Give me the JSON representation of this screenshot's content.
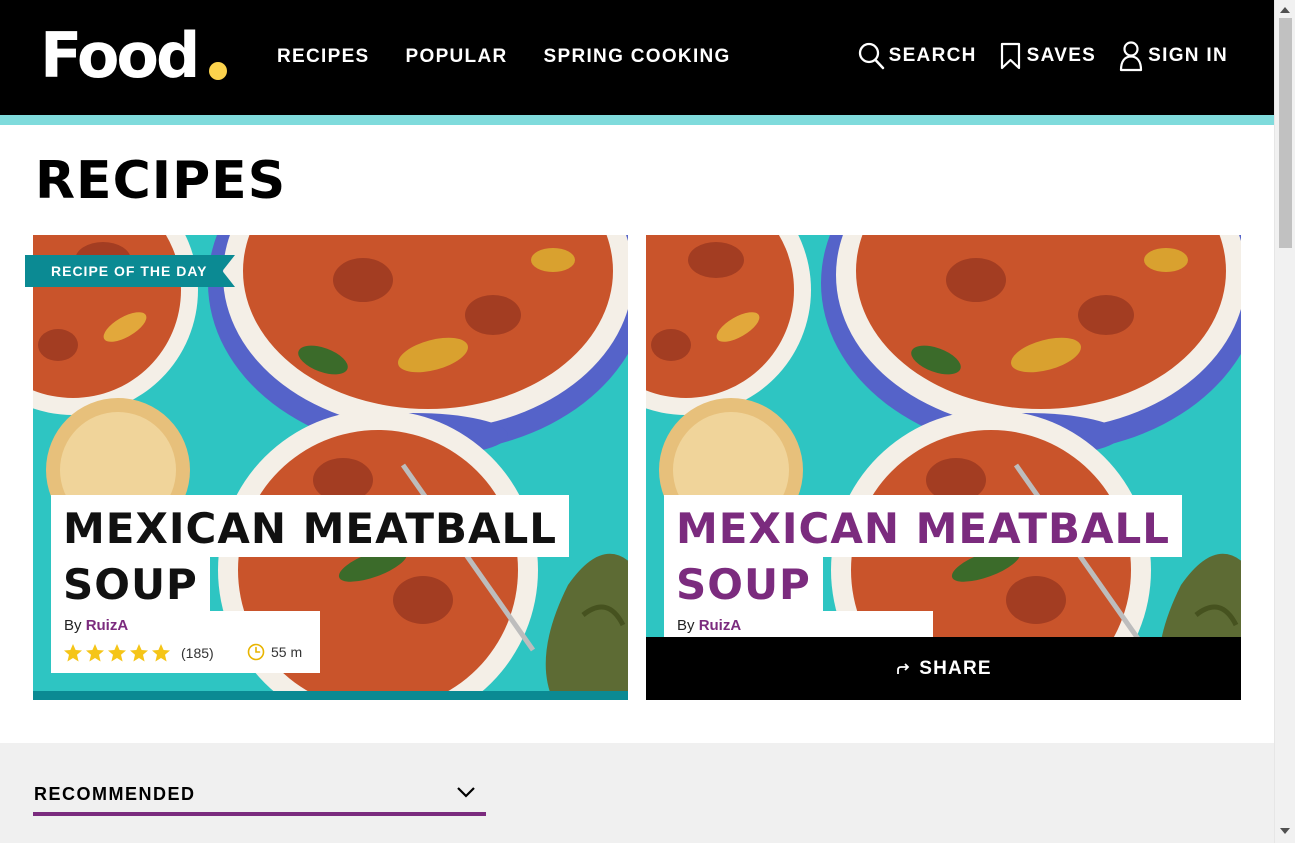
{
  "header": {
    "logo": "Food",
    "nav": [
      "RECIPES",
      "POPULAR",
      "SPRING COOKING"
    ],
    "tools": {
      "search": {
        "label": "SEARCH",
        "icon": "search-icon"
      },
      "saves": {
        "label": "SAVES",
        "icon": "bookmark-icon"
      },
      "signin": {
        "label": "SIGN IN",
        "icon": "user-icon"
      }
    }
  },
  "page": {
    "title": "RECIPES"
  },
  "cards": [
    {
      "badge": "RECIPE OF THE DAY",
      "title_line1": "MEXICAN MEATBALL",
      "title_line2": "SOUP",
      "by": "By",
      "author": "RuizA",
      "rating": 5,
      "reviews": "(185)",
      "time": "55 m"
    },
    {
      "title_line1": "MEXICAN MEATBALL",
      "title_line2": "SOUP",
      "by": "By",
      "author": "RuizA",
      "share": "SHARE"
    }
  ],
  "recommended": {
    "label": "RECOMMENDED"
  },
  "colors": {
    "accent_purple": "#7b2b7e",
    "accent_teal": "#0b8a93",
    "strip_teal": "#7fdbdc",
    "logo_dot": "#fcd34d",
    "star": "#f5c518"
  }
}
